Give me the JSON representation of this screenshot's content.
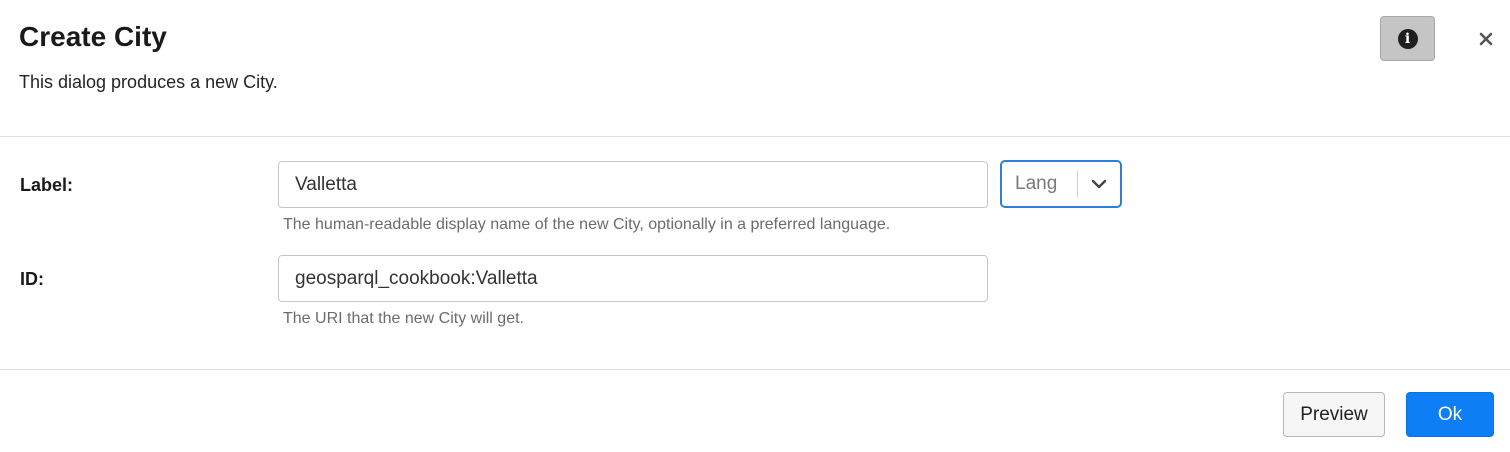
{
  "dialog": {
    "title": "Create City",
    "subtitle": "This dialog produces a new City.",
    "info_icon": "info-icon",
    "close_icon": "close-icon"
  },
  "form": {
    "label_field": {
      "label": "Label:",
      "value": "Valletta",
      "help": "The human-readable display name of the new City, optionally in a preferred language.",
      "lang_placeholder": "Lang"
    },
    "id_field": {
      "label": "ID:",
      "value": "geosparql_cookbook:Valletta",
      "help": "The URI that the new City will get."
    }
  },
  "footer": {
    "preview_label": "Preview",
    "ok_label": "Ok"
  },
  "colors": {
    "primary": "#0d7ef5",
    "focus_border": "#2f7fd8",
    "info_button_bg": "#c5c5c5"
  }
}
